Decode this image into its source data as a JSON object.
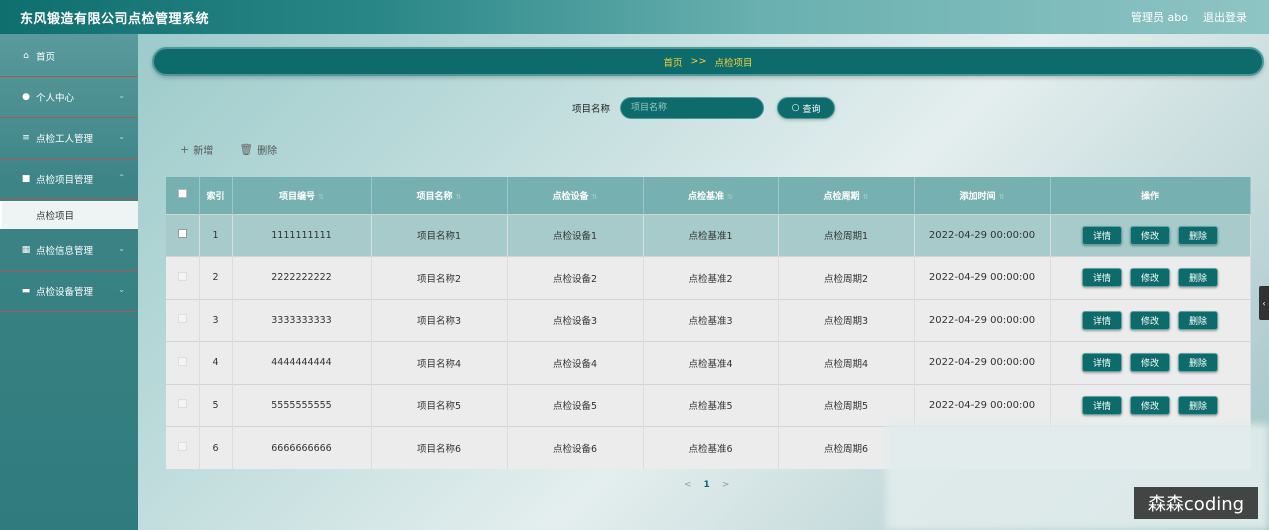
{
  "header": {
    "title": "东风锻造有限公司点检管理系统",
    "user_label": "管理员 abo",
    "logout_label": "退出登录"
  },
  "sidebar": {
    "items": [
      {
        "label": "首页",
        "icon": "home-icon"
      },
      {
        "label": "个人中心",
        "icon": "user-icon"
      },
      {
        "label": "点检工人管理",
        "icon": "list-icon"
      },
      {
        "label": "点检项目管理",
        "icon": "comment-icon"
      },
      {
        "label": "点检项目",
        "icon": ""
      },
      {
        "label": "点检信息管理",
        "icon": "grid-icon"
      },
      {
        "label": "点检设备管理",
        "icon": "briefcase-icon"
      }
    ]
  },
  "breadcrumb": {
    "home": "首页",
    "separator": ">>",
    "current": "点检项目"
  },
  "search": {
    "label": "项目名称",
    "placeholder": "项目名称",
    "query_label": "查询"
  },
  "actions": {
    "add_label": "新增",
    "delete_label": "删除"
  },
  "table": {
    "headers": [
      "索引",
      "项目编号",
      "项目名称",
      "点检设备",
      "点检基准",
      "点检周期",
      "添加时间",
      "操作"
    ],
    "rows": [
      {
        "index": "1",
        "code": "1111111111",
        "name": "项目名称1",
        "device": "点检设备1",
        "standard": "点检基准1",
        "cycle": "点检周期1",
        "time": "2022-04-29 00:00:00"
      },
      {
        "index": "2",
        "code": "2222222222",
        "name": "项目名称2",
        "device": "点检设备2",
        "standard": "点检基准2",
        "cycle": "点检周期2",
        "time": "2022-04-29 00:00:00"
      },
      {
        "index": "3",
        "code": "3333333333",
        "name": "项目名称3",
        "device": "点检设备3",
        "standard": "点检基准3",
        "cycle": "点检周期3",
        "time": "2022-04-29 00:00:00"
      },
      {
        "index": "4",
        "code": "4444444444",
        "name": "项目名称4",
        "device": "点检设备4",
        "standard": "点检基准4",
        "cycle": "点检周期4",
        "time": "2022-04-29 00:00:00"
      },
      {
        "index": "5",
        "code": "5555555555",
        "name": "项目名称5",
        "device": "点检设备5",
        "standard": "点检基准5",
        "cycle": "点检周期5",
        "time": "2022-04-29 00:00:00"
      },
      {
        "index": "6",
        "code": "6666666666",
        "name": "项目名称6",
        "device": "点检设备6",
        "standard": "点检基准6",
        "cycle": "点检周期6",
        "time": ""
      }
    ],
    "op_detail": "详情",
    "op_edit": "修改",
    "op_delete": "删除"
  },
  "pager": {
    "prev": "<",
    "current": "1",
    "next": ">"
  },
  "watermark": "森森coding",
  "colors": {
    "primary": "#0e6b6b",
    "header_bg": "#77b0b0",
    "breadcrumb_text": "#f4d03f"
  }
}
